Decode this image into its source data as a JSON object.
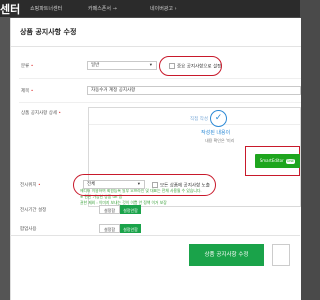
{
  "topbar": {
    "brand": "센터",
    "nav": [
      "쇼핑파트너센터",
      "카페스폰서 →",
      "네이버광고 ›"
    ]
  },
  "modal": {
    "title": "상품 공지사항 수정",
    "fields": {
      "category": {
        "label": "분류",
        "value": "일반",
        "option_label": "중요 공지사항으로 설정"
      },
      "subject": {
        "label": "제목",
        "value": "자동수거 계정 공지사항"
      },
      "body": {
        "label": "상품 공지사항 상세",
        "tab_label": "직접 작성",
        "done_text": "작성된 내용이",
        "sub_text": "내용 확인은 '미리",
        "editor_button": "SmartEditor",
        "editor_badge": "ONE",
        "notes": [
          "에디터 이용하여 회원등록 일부 오프라인 및 대표는 전체 사용될 수 있습니다.",
          "※ 권한 가능한 상품 url 등",
          "권한 제외 : 이미지 보내는 것이 이쁨 안 정책 이거 보장"
        ]
      },
      "display_scope": {
        "label": "전시위치",
        "value": "전체",
        "option_label": "모든 상품에 공지사항 노출"
      },
      "display_period": {
        "label": "전시기간 설정",
        "off": "설정함",
        "on": "설정안함"
      },
      "popup": {
        "label": "팝업사용",
        "off": "설정함",
        "on": "설정안함"
      }
    },
    "submit_button": "상품 공지사항 수정"
  },
  "colors": {
    "accent_green": "#1aa34a",
    "annotation_red": "#c8192b",
    "link_blue": "#2d8ad6"
  }
}
